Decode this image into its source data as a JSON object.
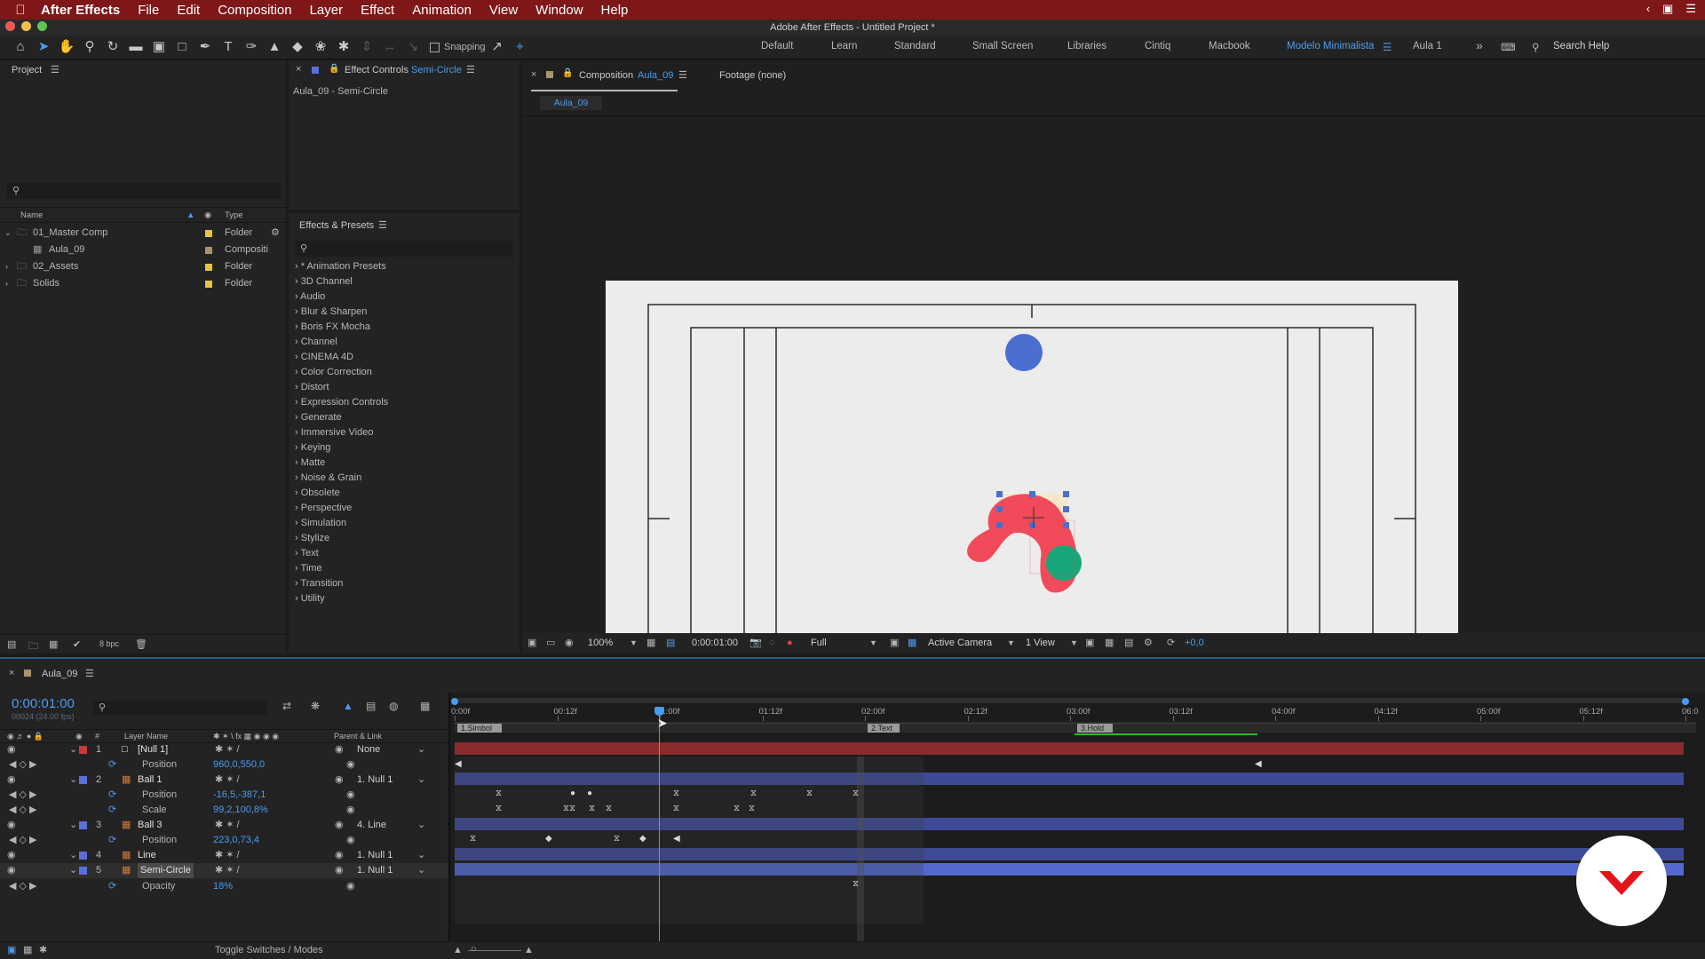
{
  "menubar": {
    "app": "After Effects",
    "items": [
      "File",
      "Edit",
      "Composition",
      "Layer",
      "Effect",
      "Animation",
      "View",
      "Window",
      "Help"
    ]
  },
  "window_title": "Adobe After Effects - Untitled Project *",
  "toolbar": {
    "snapping_label": "Snapping",
    "workspaces": [
      "Default",
      "Learn",
      "Standard",
      "Small Screen",
      "Libraries",
      "Cintiq",
      "Macbook",
      "Modelo Minimalista",
      "Aula 1"
    ],
    "active_workspace": "Modelo Minimalista",
    "search_placeholder": "Search Help"
  },
  "project": {
    "title": "Project",
    "col_name": "Name",
    "col_type": "Type",
    "bpc": "8 bpc",
    "items": [
      {
        "name": "01_Master Comp",
        "type": "Folder"
      },
      {
        "name": "Aula_09",
        "type": "Compositi"
      },
      {
        "name": "02_Assets",
        "type": "Folder"
      },
      {
        "name": "Solids",
        "type": "Folder"
      }
    ]
  },
  "effect_controls": {
    "tab_prefix": "Effect Controls",
    "tab_layer": "Semi-Circle",
    "subtitle": "Aula_09 - Semi-Circle"
  },
  "effects_presets": {
    "title": "Effects & Presets",
    "items": [
      "* Animation Presets",
      "3D Channel",
      "Audio",
      "Blur & Sharpen",
      "Boris FX Mocha",
      "Channel",
      "CINEMA 4D",
      "Color Correction",
      "Distort",
      "Expression Controls",
      "Generate",
      "Immersive Video",
      "Keying",
      "Matte",
      "Noise & Grain",
      "Obsolete",
      "Perspective",
      "Simulation",
      "Stylize",
      "Text",
      "Time",
      "Transition",
      "Utility"
    ]
  },
  "composition": {
    "tab_prefix": "Composition",
    "tab_name": "Aula_09",
    "footage_tab": "Footage (none)",
    "breadcrumb": "Aula_09",
    "footer": {
      "zoom": "100%",
      "timecode": "0:00:01:00",
      "resolution": "Full",
      "camera": "Active Camera",
      "view": "1 View",
      "exposure": "+0,0"
    }
  },
  "timeline": {
    "comp_name": "Aula_09",
    "timecode": "0:00:01:00",
    "frame_info": "00024 (24.00 fps)",
    "col_layer_name": "Layer Name",
    "col_parent": "Parent & Link",
    "toggle_label": "Toggle Switches / Modes",
    "ruler": [
      "0:00f",
      "00:12f",
      "01:00f",
      "01:12f",
      "02:00f",
      "02:12f",
      "03:00f",
      "03:12f",
      "04:00f",
      "04:12f",
      "05:00f",
      "05:12f",
      "06:0"
    ],
    "markers": [
      "1.Simbol",
      "2.Text",
      "3.Hold"
    ],
    "layers": [
      {
        "num": "1",
        "name": "[Null 1]",
        "parent": "None",
        "color": "#c63b3b"
      },
      {
        "prop": "Position",
        "value": "960,0,550,0"
      },
      {
        "num": "2",
        "name": "Ball 1",
        "parent": "1. Null 1",
        "color": "#5b6fd8"
      },
      {
        "prop": "Position",
        "value": "-16,5,-387,1"
      },
      {
        "prop": "Scale",
        "value": "99,2,100,8%"
      },
      {
        "num": "3",
        "name": "Ball 3",
        "parent": "4. Line",
        "color": "#5b6fd8"
      },
      {
        "prop": "Position",
        "value": "223,0,73,4"
      },
      {
        "num": "4",
        "name": "Line",
        "parent": "1. Null 1",
        "color": "#5b6fd8"
      },
      {
        "num": "5",
        "name": "Semi-Circle",
        "parent": "1. Null 1",
        "color": "#5b6fd8"
      },
      {
        "prop": "Opacity",
        "value": "18%"
      }
    ]
  },
  "colors": {
    "menubar": "#7f1718",
    "accent": "#4a9cf0",
    "ball_blue": "#4a6fd0",
    "semi_circle_red": "#f14a5a",
    "ball_green": "#16a679"
  }
}
